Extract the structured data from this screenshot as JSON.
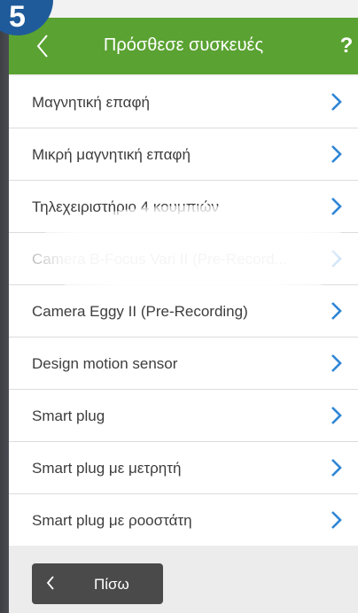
{
  "badge": {
    "step": "5"
  },
  "navbar": {
    "title": "Πρόσθεσε συσκευές",
    "help_label": "?"
  },
  "devices": [
    {
      "label": "Μαγνητική επαφή"
    },
    {
      "label": "Μικρή μαγνητική επαφή"
    },
    {
      "label": "Τηλεχειριστήριο 4 κουμπιών"
    },
    {
      "label": "Camera B-Focus Vari II (Pre-Record..."
    },
    {
      "label": "Camera Eggy II (Pre-Recording)"
    },
    {
      "label": "Design motion sensor"
    },
    {
      "label": "Smart plug"
    },
    {
      "label": "Smart plug με μετρητή"
    },
    {
      "label": "Smart plug με ροοστάτη"
    }
  ],
  "footer": {
    "back_label": "Πίσω"
  },
  "colors": {
    "accent": "#5aa232",
    "chevron": "#2f86d6",
    "badge": "#1f5b9a",
    "back_button": "#4a4a4a"
  },
  "icons": {
    "back": "chevron-left-icon",
    "help": "question-icon",
    "row": "chevron-right-icon"
  }
}
